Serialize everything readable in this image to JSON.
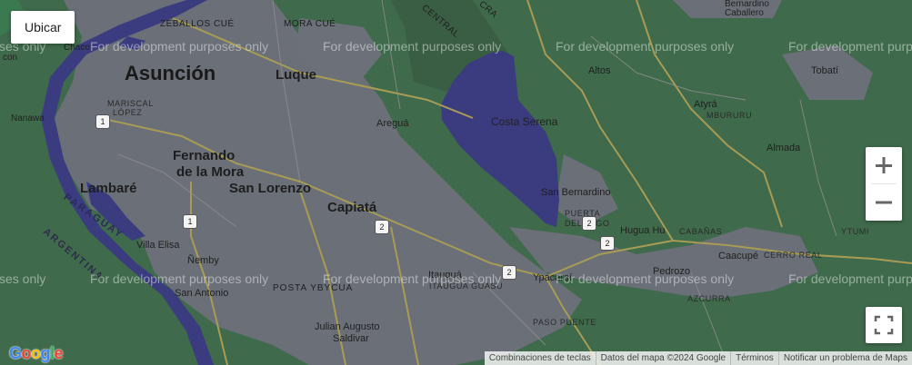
{
  "controls": {
    "locate_label": "Ubicar"
  },
  "colors": {
    "terrain": "#3f6a4b",
    "urban": "#6a6f78",
    "water": "#3b3c80",
    "road_major": "#a89c55",
    "road_minor": "#8f8f8f"
  },
  "icons": {
    "zoom_in": "plus-icon",
    "zoom_out": "minus-icon",
    "fullscreen": "fullscreen-icon"
  },
  "watermark": "For development purposes only",
  "watermark_partial": "ses only",
  "labels": {
    "asuncion": "Asunción",
    "luque": "Luque",
    "fernando": "Fernando",
    "de_la_mora": "de la Mora",
    "san_lorenzo": "San Lorenzo",
    "lambare": "Lambaré",
    "capiata": "Capiatá",
    "costa_serena": "Costa Serena",
    "san_bernardino": "San Bernardino",
    "aregua": "Areguá",
    "altos": "Altos",
    "atyra": "Atyrá",
    "tobati": "Tobatí",
    "almada": "Almada",
    "hugua_hu": "Hugua Hu",
    "caacupe": "Caacupé",
    "pedrozo": "Pedrozo",
    "ypacarai": "Ypacaraí",
    "villa_elisa": "Villa Elisa",
    "nemby": "Ñemby",
    "san_antonio": "San Antonio",
    "julian": "Julian Augusto",
    "saldivar": "Saldivar",
    "itaugua": "Itauguá",
    "nanawa": "Nanawa",
    "chaco": "Chaco",
    "zeballos": "ZEBALLOS CUÉ",
    "mora_cue": "MORA CUÉ",
    "mariscal": "MARISCAL",
    "lopez": "LÓPEZ",
    "posta_ybycua": "POSTA YBYCUA",
    "itaugua_guasu": "ITAUGUA GUASU",
    "paso_puente": "PASO PUENTE",
    "puerta": "PUERTA",
    "del_lago": "DEL LAGO",
    "cabanas": "CABAÑAS",
    "cerro_real": "CERRO REAL",
    "ytumi": "YTUMI",
    "azcurra": "AZCURRA",
    "mburuku": "MBURURU",
    "central": "CENTRAL",
    "cra": "CRA",
    "bernardino": "Bernardino",
    "caballero": "Caballero",
    "paraguay_river": "PARAGUAY",
    "argentina": "ARGENTINA",
    "con_partial": "con"
  },
  "shields": [
    "1",
    "1",
    "2",
    "2",
    "2",
    "2",
    "1"
  ],
  "attribution": {
    "shortcuts": "Combinaciones de teclas",
    "map_data": "Datos del mapa ©2024 Google",
    "terms": "Términos",
    "report": "Notificar un problema de Maps"
  },
  "logo": "Google"
}
